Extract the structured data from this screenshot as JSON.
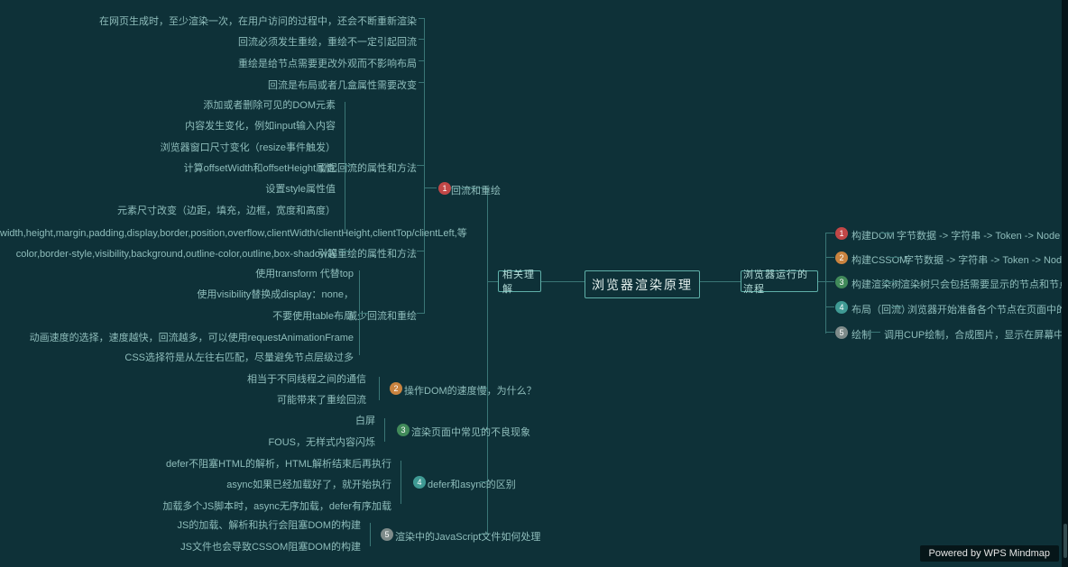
{
  "root": "浏览器渲染原理",
  "left_lv2": "相关理解",
  "right_lv2": "浏览器运行的流程",
  "right_branches": {
    "b1": {
      "num": "1",
      "label": "构建DOM",
      "detail": "字节数据 -> 字符串 -> Token -> Node -> DOM"
    },
    "b2": {
      "num": "2",
      "label": "构建CSSOM",
      "detail": "字节数据 -> 字符串 -> Token -> Node -> CSSOM"
    },
    "b3": {
      "num": "3",
      "label": "构建渲染树",
      "detail": "渲染树只会包括需要显示的节点和节点的样式"
    },
    "b4": {
      "num": "4",
      "label": "布局（回流）",
      "detail": "浏览器开始准备各个节点在页面中的准确位置和大小"
    },
    "b5": {
      "num": "5",
      "label": "绘制",
      "detail": "调用CUP绘制，合成图片，显示在屏幕中"
    }
  },
  "left_groups": {
    "g1": {
      "num": "1",
      "title": "回流和重绘",
      "top_lines": [
        "在网页生成时，至少渲染一次，在用户访问的过程中，还会不断重新渲染",
        "回流必须发生重绘，重绘不一定引起回流",
        "重绘是给节点需要更改外观而不影响布局",
        "回流是布局或者几盒属性需要改变"
      ],
      "sub1_title": "引起回流的属性和方法",
      "sub1": [
        "添加或者删除可见的DOM元素",
        "内容发生变化，例如input输入内容",
        "浏览器窗口尺寸变化（resize事件触发）",
        "计算offsetWidth和offsetHeight属性",
        "设置style属性值",
        "元素尺寸改变（边距，填充，边框，宽度和高度）",
        "width,height,margin,padding,display,border,position,overflow,clientWidth/clientHeight,clientTop/clientLeft,等"
      ],
      "sub2_title": "引起重绘的属性和方法",
      "sub2": [
        "color,border-style,visibility,background,outline-color,outline,box-shadow等"
      ],
      "sub3_title": "减少回流和重绘",
      "sub3": [
        "使用transform 代替top",
        "使用visibility替换成display：none，",
        "不要使用table布局",
        "动画速度的选择，速度越快，回流越多，可以使用requestAnimationFrame",
        "CSS选择符是从左往右匹配，尽量避免节点层级过多"
      ]
    },
    "g2": {
      "num": "2",
      "title": "操作DOM的速度慢，为什么？",
      "lines": [
        "相当于不同线程之间的通信",
        "可能带来了重绘回流"
      ]
    },
    "g3": {
      "num": "3",
      "title": "渲染页面中常见的不良现象",
      "lines": [
        "白屏",
        "FOUS，无样式内容闪烁"
      ]
    },
    "g4": {
      "num": "4",
      "title": "defer和async的区别",
      "lines": [
        "defer不阻塞HTML的解析，HTML解析结束后再执行",
        "async如果已经加载好了，就开始执行",
        "加载多个JS脚本时，async无序加载，defer有序加载"
      ]
    },
    "g5": {
      "num": "5",
      "title": "渲染中的JavaScript文件如何处理",
      "lines": [
        "JS的加载、解析和执行会阻塞DOM的构建",
        "JS文件也会导致CSSOM阻塞DOM的构建"
      ]
    }
  },
  "footer": "Powered by WPS Mindmap"
}
